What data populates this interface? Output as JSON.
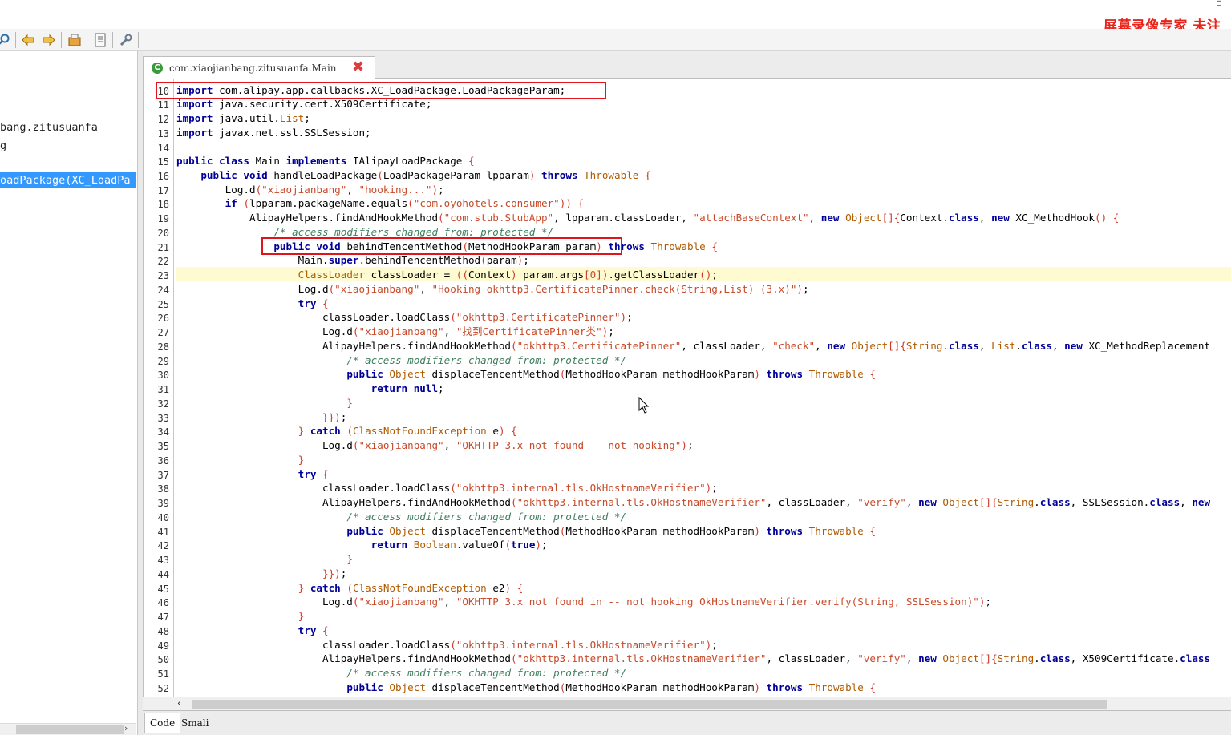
{
  "watermark": "屏幕录像专家 未注",
  "toolbar": {
    "icons": [
      "search-icon",
      "back-arrow-icon",
      "forward-arrow-icon",
      "open-archive-icon",
      "log-icon",
      "settings-wrench-icon"
    ]
  },
  "tree": {
    "rows": [
      "bang.zitusuanfa",
      "g",
      "oadPackage(XC_LoadPa"
    ]
  },
  "editor": {
    "tab_label": "com.xiaojianbang.zitusuanfa.Main",
    "close_symbol": "✖"
  },
  "code": {
    "line_numbers": [
      "10",
      "11",
      "12",
      "13",
      "14",
      "15",
      "16",
      "17",
      "18",
      "19",
      "20",
      "21",
      "22",
      "23",
      "24",
      "25",
      "26",
      "27",
      "28",
      "29",
      "30",
      "31",
      "32",
      "33",
      "34",
      "35",
      "36",
      "37",
      "38",
      "39",
      "40",
      "41",
      "42",
      "43",
      "44",
      "45",
      "46",
      "47",
      "48",
      "49",
      "50",
      "51",
      "52"
    ],
    "current_line": "23",
    "highlighted_lines": [
      "10",
      "21"
    ]
  },
  "bottom_tabs": {
    "code": "Code",
    "smali": "Smali"
  },
  "colors": {
    "keyword": "#000099",
    "string": "#c84a2a",
    "comment": "#3f7f5f",
    "type": "#b05a00",
    "selection": "#3399ff",
    "highlight_box": "#e0151b",
    "current_line": "#fffbd0"
  }
}
